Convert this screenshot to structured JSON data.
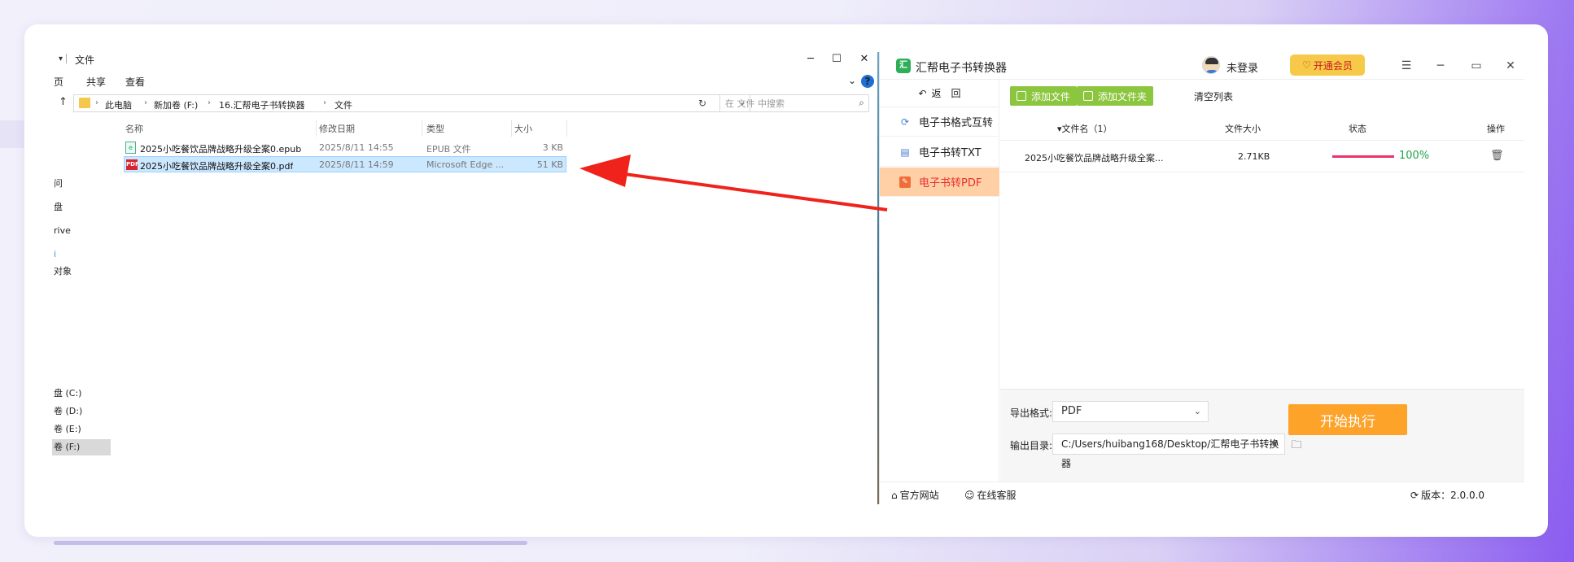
{
  "explorer": {
    "window_title": "文件",
    "ribbon": [
      "页",
      "共享",
      "查看"
    ],
    "address": [
      "此电脑",
      "新加卷 (F:)",
      "16.汇帮电子书转换器",
      "文件"
    ],
    "search_placeholder": "在 文件 中搜索",
    "nav": [
      "问",
      "盘",
      "rive",
      "i",
      "对象",
      "盘 (C:)",
      "卷 (D:)",
      "卷 (E:)",
      "卷 (F:)"
    ],
    "columns": {
      "name": "名称",
      "modified": "修改日期",
      "type": "类型",
      "size": "大小"
    },
    "files": [
      {
        "name": "2025小吃餐饮品牌战略升级全案0.epub",
        "modified": "2025/8/11 14:55",
        "type": "EPUB 文件",
        "size": "3 KB",
        "icon": "epub-file-icon"
      },
      {
        "name": "2025小吃餐饮品牌战略升级全案0.pdf",
        "modified": "2025/8/11 14:59",
        "type": "Microsoft Edge ...",
        "size": "51 KB",
        "icon": "pdf-file-icon"
      }
    ]
  },
  "app": {
    "title": "汇帮电子书转换器",
    "user": "未登录",
    "vip_label": "开通会员",
    "back_label": "返　回",
    "menu": [
      {
        "label": "电子书格式互转",
        "icon": "refresh-icon"
      },
      {
        "label": "电子书转TXT",
        "icon": "document-icon"
      },
      {
        "label": "电子书转PDF",
        "icon": "pdf-icon"
      }
    ],
    "toolbar": {
      "add_file": "添加文件",
      "add_folder": "添加文件夹",
      "clear": "清空列表"
    },
    "table": {
      "col_name": "文件名（1）",
      "col_size": "文件大小",
      "col_status": "状态",
      "col_action": "操作",
      "rows": [
        {
          "name": "2025小吃餐饮品牌战略升级全案...",
          "size": "2.71KB",
          "progress": 1.0,
          "status": "100%"
        }
      ]
    },
    "export": {
      "format_label": "导出格式:",
      "format_value": "PDF",
      "dir_label": "输出目录:",
      "dir_value": "C:/Users/huibang168/Desktop/汇帮电子书转换器",
      "start": "开始执行"
    },
    "footer": {
      "site": "官方网站",
      "service": "在线客服",
      "version": "版本：2.0.0.0"
    }
  },
  "colors": {
    "accent_green": "#8cc63f",
    "active_menu_bg": "#ffd0a5",
    "active_menu_text": "#e8312f",
    "start_orange": "#fea32a",
    "arrow_red": "#f0221c"
  }
}
